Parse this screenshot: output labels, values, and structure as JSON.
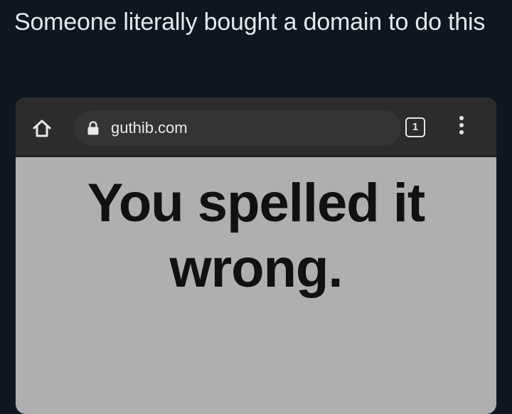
{
  "post": {
    "text": "Someone literally bought a domain to do this"
  },
  "browser": {
    "url": "guthib.com",
    "tab_count": "1",
    "icons": {
      "home": "home-icon",
      "lock": "lock-icon",
      "tabs": "tabs-counter-icon",
      "menu": "kebab-menu-icon"
    }
  },
  "page": {
    "heading_line1": "You spelled it",
    "heading_line2": "wrong."
  }
}
